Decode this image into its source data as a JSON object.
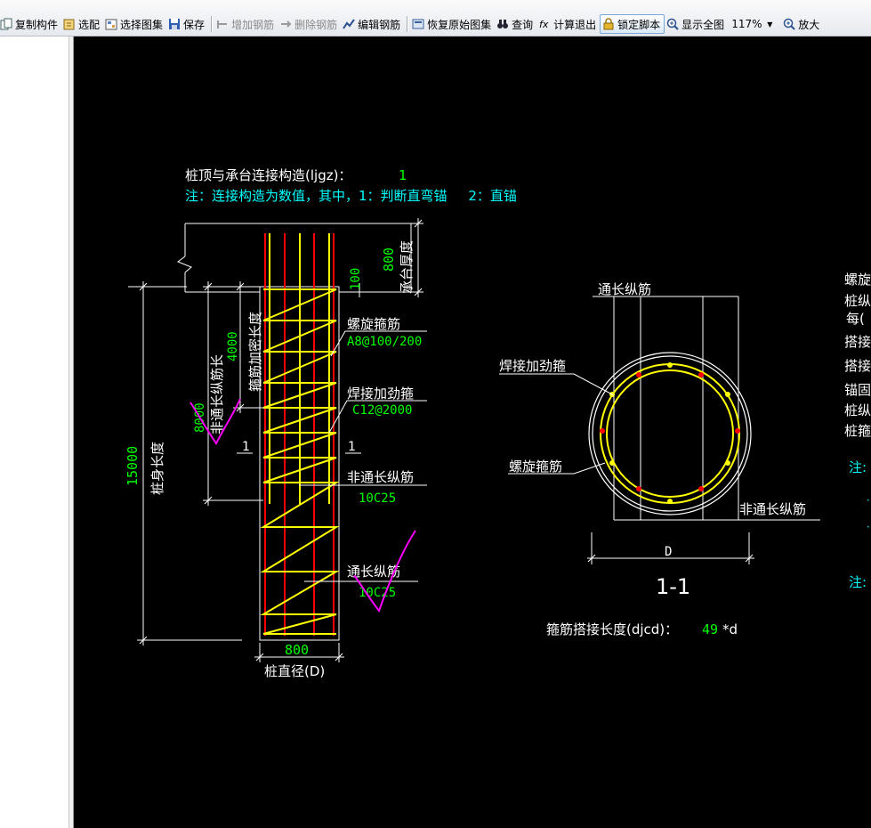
{
  "toolbar": {
    "zoom": "117%",
    "buttons": [
      {
        "id": "copy",
        "label": "复制构件",
        "icon": "copy-icon",
        "state": "normal"
      },
      {
        "id": "select",
        "label": "选配",
        "icon": "select-icon",
        "state": "normal"
      },
      {
        "id": "select_atlas",
        "label": "选择图集",
        "icon": "atlas-icon",
        "state": "normal"
      },
      {
        "id": "save",
        "label": "保存",
        "icon": "save-icon",
        "state": "normal"
      },
      {
        "id": "add_rebar",
        "label": "增加钢筋",
        "icon": "add-rebar-icon",
        "state": "disabled"
      },
      {
        "id": "delete_rebar",
        "label": "删除钢筋",
        "icon": "delete-rebar-icon",
        "state": "disabled"
      },
      {
        "id": "edit_rebar",
        "label": "编辑钢筋",
        "icon": "edit-rebar-icon",
        "state": "normal"
      },
      {
        "id": "restore",
        "label": "恢复原始图集",
        "icon": "restore-icon",
        "state": "normal"
      },
      {
        "id": "query",
        "label": "查询",
        "icon": "binoculars-icon",
        "state": "normal"
      },
      {
        "id": "calc_exit",
        "label": "计算退出",
        "icon": "function-icon",
        "state": "normal"
      },
      {
        "id": "lock_script",
        "label": "锁定脚本",
        "icon": "lock-icon",
        "state": "active"
      },
      {
        "id": "show_all",
        "label": "显示全图",
        "icon": "zoom-extents-icon",
        "state": "normal"
      },
      {
        "id": "zoom_in",
        "label": "放大",
        "icon": "zoom-in-icon",
        "state": "normal"
      }
    ]
  },
  "colors": {
    "canvas_bg": "#000000",
    "white": "#ffffff",
    "green": "#00ff00",
    "cyan": "#00ffff",
    "yellow": "#ffff00",
    "red": "#ff0000",
    "magenta": "#ff00ff"
  },
  "drawing": {
    "header_line": "桩顶与承台连接构造(ljgz)：",
    "header_value": "1",
    "note_line": "注：连接构造为数值，其中，1：判断直弯锚     2：直锚",
    "cap_thickness_label": "承台厚度",
    "cap_thickness_value": "800",
    "anchor_value": "100",
    "dense_zone_label": "箍筋加密长度",
    "dense_zone_value": "4000",
    "nonfull_length_label": "非通长纵筋长",
    "nonfull_length_value": "8000",
    "pile_length_label": "桩身长度",
    "pile_length_value": "15000",
    "spiral_label": "螺旋箍筋",
    "spiral_value": "A8@100/200",
    "weld_label": "焊接加劲箍",
    "weld_value": "C12@2000",
    "nonfull_label": "非通长纵筋",
    "nonfull_value": "10C25",
    "full_label": "通长纵筋",
    "full_value": "10C25",
    "diameter_value": "800",
    "diameter_label": "桩直径(D)",
    "section_mark": "1",
    "section_title": "1-1",
    "sec_full_label": "通长纵筋",
    "sec_weld_label": "焊接加劲箍",
    "sec_spiral_label": "螺旋箍筋",
    "sec_nonfull_label": "非通长纵筋",
    "sec_d_label": "D",
    "lap_label": "箍筋搭接长度(djcd)：",
    "lap_value": "49",
    "lap_unit": "*d",
    "side_texts": [
      "螺旋",
      "桩纵",
      "每(",
      "搭接",
      "搭接",
      "锚固",
      "桩纵",
      "桩箍"
    ],
    "side_notes": [
      "注:",
      "注:"
    ]
  }
}
